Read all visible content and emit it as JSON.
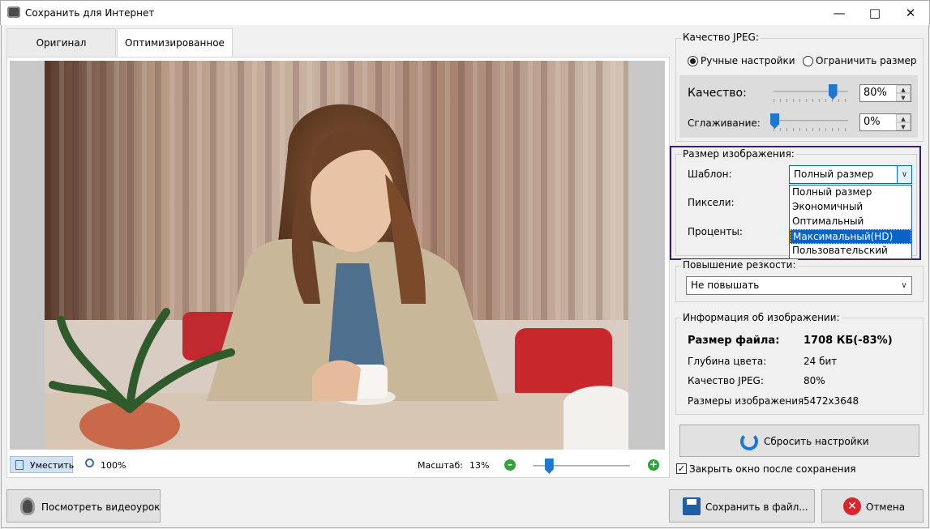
{
  "window": {
    "title": "Сохранить для Интернет"
  },
  "tabs": [
    {
      "label": "Оригинал",
      "active": false
    },
    {
      "label": "Оптимизированное",
      "active": true
    }
  ],
  "viewer": {
    "fit_label": "Уместить",
    "actual_size_label": "100%",
    "zoom_label": "Масштаб:",
    "zoom_value": "13%",
    "zoom_fraction": 0.15
  },
  "jpeg_quality": {
    "group_label": "Качество JPEG:",
    "radio_manual": "Ручные настройки",
    "radio_limit": "Ограничить размер",
    "selected": "manual",
    "quality_label": "Качество:",
    "quality_value": "80%",
    "quality_level": 0.8,
    "smoothing_label": "Сглаживание:",
    "smoothing_value": "0%",
    "smoothing_level": 0.0
  },
  "image_size": {
    "group_label": "Размер изображения:",
    "template_label": "Шаблон:",
    "template_value": "Полный размер",
    "pixels_label": "Пиксели:",
    "percent_label": "Проценты:",
    "options": [
      "Полный размер",
      "Экономичный",
      "Оптимальный",
      "Максимальный(HD)",
      "Пользовательский"
    ],
    "highlighted_option": 3
  },
  "sharpen": {
    "group_label": "Повышение резкости:",
    "value": "Не повышать"
  },
  "info": {
    "group_label": "Информация об изображении:",
    "file_size_label": "Размер файла:",
    "file_size_value": "1708 КБ(-83%)",
    "color_depth_label": "Глубина цвета:",
    "color_depth_value": "24 бит",
    "jpeg_quality_label": "Качество JPEG:",
    "jpeg_quality_value": "80%",
    "dimensions_label": "Размеры изображения:",
    "dimensions_value": "5472x3648"
  },
  "reset_button": "Сбросить настройки",
  "close_after_save": {
    "label": "Закрыть окно после сохранения",
    "checked": true
  },
  "footer": {
    "video_button": "Посмотреть видеоурок",
    "save_button": "Сохранить в файл...",
    "cancel_button": "Отмена"
  },
  "colors": {
    "accent": "#1e78d2",
    "highlight_border": "#3b1f6e",
    "selection": "#0a64c8"
  }
}
